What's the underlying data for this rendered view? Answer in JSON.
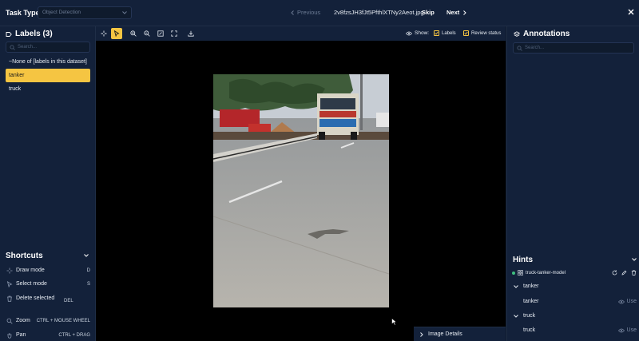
{
  "topbar": {
    "task_type_label": "Task Type",
    "task_type_value": "Object Detection",
    "previous_label": "Previous",
    "filename": "2v8fzsJH3fJt5PfthlXTNy2Aeot.jpg",
    "skip_label": "Skip",
    "next_label": "Next"
  },
  "labels_panel": {
    "title": "Labels (3)",
    "search_placeholder": "Search...",
    "items": [
      {
        "label": "~None of [labels in this dataset]",
        "selected": false
      },
      {
        "label": "tanker",
        "selected": true
      },
      {
        "label": "truck",
        "selected": false
      }
    ]
  },
  "shortcuts": {
    "title": "Shortcuts",
    "items": [
      {
        "name": "Draw mode",
        "key": "D",
        "icon": "crosshair-icon"
      },
      {
        "name": "Select mode",
        "key": "S",
        "icon": "cursor-icon"
      },
      {
        "name": "Delete selected",
        "key": "DEL",
        "icon": "trash-icon"
      },
      {
        "name": "Zoom",
        "key": "CTRL  +  MOUSE WHEEL",
        "icon": "search-icon"
      },
      {
        "name": "Pan",
        "key": "CTRL  +  DRAG",
        "icon": "hand-icon"
      }
    ]
  },
  "toolbar": {
    "show_label": "Show:",
    "labels_checkbox": "Labels",
    "review_checkbox": "Review status"
  },
  "annotations_panel": {
    "title": "Annotations",
    "search_placeholder": "Search..."
  },
  "hints": {
    "title": "Hints",
    "model_name": "truck-tanker-model",
    "groups": [
      {
        "name": "tanker",
        "item": "tanker",
        "use_label": "Use"
      },
      {
        "name": "truck",
        "item": "truck",
        "use_label": "Use"
      }
    ]
  },
  "image_details_label": "Image Details",
  "colors": {
    "accent": "#f5c542",
    "panel": "#13213a",
    "background": "#0f1b2d",
    "model_status": "#3fbf7f"
  }
}
